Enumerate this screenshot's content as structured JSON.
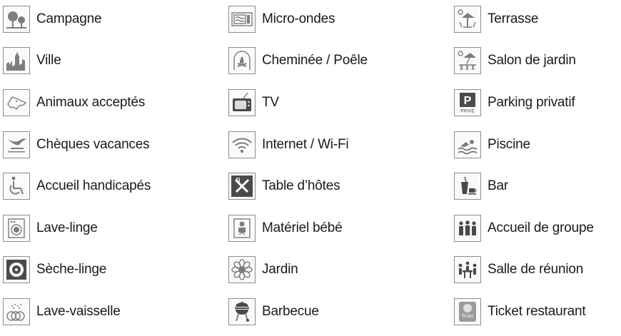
{
  "columns": [
    {
      "items": [
        {
          "label": "Campagne",
          "icon": "countryside-trees-icon"
        },
        {
          "label": "Ville",
          "icon": "city-skyline-icon"
        },
        {
          "label": "Animaux acceptés",
          "icon": "dog-head-icon"
        },
        {
          "label": "Chèques vacances",
          "icon": "ancv-logo-icon"
        },
        {
          "label": "Accueil handicapés",
          "icon": "wheelchair-icon"
        },
        {
          "label": "Lave-linge",
          "icon": "washing-machine-icon"
        },
        {
          "label": "Sèche-linge",
          "icon": "tumble-dryer-icon"
        },
        {
          "label": "Lave-vaisselle",
          "icon": "dishwasher-icon"
        }
      ]
    },
    {
      "items": [
        {
          "label": "Micro-ondes",
          "icon": "microwave-icon"
        },
        {
          "label": "Cheminée / Poêle",
          "icon": "fireplace-icon"
        },
        {
          "label": "TV",
          "icon": "television-icon"
        },
        {
          "label": "Internet / Wi-Fi",
          "icon": "wifi-icon"
        },
        {
          "label": "Table d’hôtes",
          "icon": "fork-knife-icon"
        },
        {
          "label": "Matériel bébé",
          "icon": "baby-icon"
        },
        {
          "label": "Jardin",
          "icon": "flower-icon"
        },
        {
          "label": "Barbecue",
          "icon": "barbecue-grill-icon"
        }
      ]
    },
    {
      "items": [
        {
          "label": "Terrasse",
          "icon": "terrace-parasol-icon"
        },
        {
          "label": "Salon de jardin",
          "icon": "garden-furniture-icon"
        },
        {
          "label": "Parking privatif",
          "icon": "parking-sign-icon",
          "badge_text": "P",
          "badge_sub": "PRIVÉ"
        },
        {
          "label": "Piscine",
          "icon": "swimmer-icon"
        },
        {
          "label": "Bar",
          "icon": "bar-drink-icon"
        },
        {
          "label": "Accueil de groupe",
          "icon": "group-people-icon"
        },
        {
          "label": "Salle de réunion",
          "icon": "meeting-table-icon"
        },
        {
          "label": "Ticket restaurant",
          "icon": "ticket-restaurant-icon",
          "badge_text": "Ticket"
        }
      ]
    }
  ]
}
